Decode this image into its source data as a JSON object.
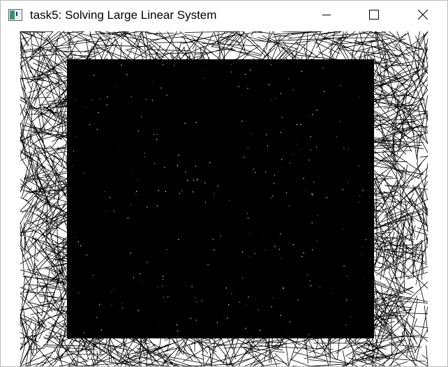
{
  "window": {
    "title": "task5: Solving Large Linear System",
    "icon": "app-window-icon",
    "controls": {
      "minimize": "minimize-icon",
      "maximize": "maximize-icon",
      "close": "close-icon"
    }
  },
  "canvas": {
    "background": "#ffffff",
    "stroke": "#000000",
    "content": "dense-wireframe-mesh"
  }
}
